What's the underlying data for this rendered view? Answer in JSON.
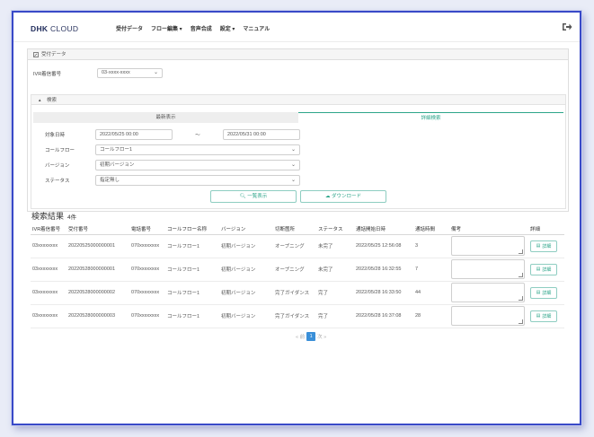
{
  "brand": {
    "bold": "DHK",
    "thin": "CLOUD"
  },
  "nav": [
    "受付データ",
    "フロー編集 ▾",
    "音声合成",
    "設定 ▾",
    "マニュアル"
  ],
  "icons": {
    "logout": "logout-icon",
    "form": "edit-icon",
    "collapse": "triangle-up-icon",
    "search": "search-icon",
    "download": "cloud-download-icon",
    "detail": "document-icon",
    "select": "chevron-down-icon"
  },
  "panel": {
    "title": "受付データ",
    "ivr_label": "IVR着信番号",
    "ivr_value": "03-xxxx-xxxx",
    "search_section": "検索",
    "tabs": [
      "最新表示",
      "詳細検索"
    ],
    "date_label": "対象日時",
    "date_from": "2022/05/25 00:00",
    "date_sep": "〜",
    "date_to": "2022/05/31 00:00",
    "callflow_label": "コールフロー",
    "callflow_value": "コールフロー1",
    "version_label": "バージョン",
    "version_value": "初期バージョン",
    "status_label": "ステータス",
    "status_value": "指定無し",
    "list_button": "一覧表示",
    "download_button": "ダウンロード"
  },
  "results": {
    "title": "検索結果",
    "count": "4件",
    "columns": [
      "IVR着信番号",
      "受付番号",
      "電話番号",
      "コールフロー名称",
      "バージョン",
      "切断箇所",
      "ステータス",
      "通話開始日時",
      "通話時間",
      "備考",
      "詳細"
    ],
    "rows": [
      [
        "03xxxxxxxx",
        "20220525000000001",
        "070xxxxxxxx",
        "コールフロー1",
        "初期バージョン",
        "オープニング",
        "未完了",
        "2022/05/25 12:56:08",
        "3"
      ],
      [
        "03xxxxxxxx",
        "20220528000000001",
        "070xxxxxxxx",
        "コールフロー1",
        "初期バージョン",
        "オープニング",
        "未完了",
        "2022/05/28 16:32:55",
        "7"
      ],
      [
        "03xxxxxxxx",
        "20220528000000002",
        "070xxxxxxxx",
        "コールフロー1",
        "初期バージョン",
        "完了ガイダンス",
        "完了",
        "2022/05/28 16:33:50",
        "44"
      ],
      [
        "03xxxxxxxx",
        "20220528000000003",
        "070xxxxxxxx",
        "コールフロー1",
        "初期バージョン",
        "完了ガイダンス",
        "完了",
        "2022/05/28 16:37:08",
        "28"
      ]
    ],
    "detail_label": "詳細"
  },
  "pager": {
    "prev": "« 前",
    "current": "1",
    "next": "次 »"
  },
  "colors": {
    "accent": "#2da58a",
    "frame": "#3949c8",
    "pager_active": "#3a8fd8"
  }
}
